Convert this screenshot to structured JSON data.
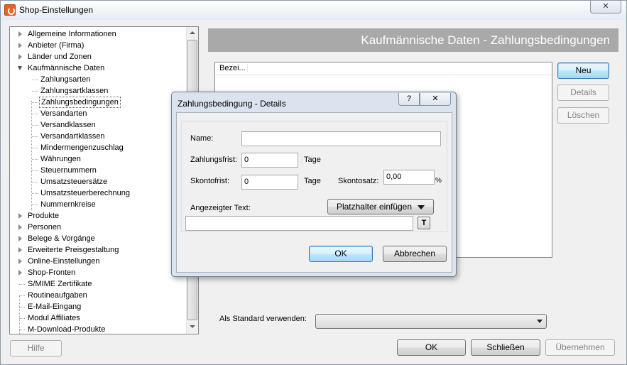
{
  "window": {
    "title": "Shop-Einstellungen",
    "close_glyph": "✕"
  },
  "tree": {
    "items": [
      {
        "label": "Allgemeine Informationen",
        "level": 0,
        "state": "closed"
      },
      {
        "label": "Anbieter (Firma)",
        "level": 0,
        "state": "closed"
      },
      {
        "label": "Länder und Zonen",
        "level": 0,
        "state": "closed"
      },
      {
        "label": "Kaufmännische Daten",
        "level": 0,
        "state": "open"
      },
      {
        "label": "Zahlungsarten",
        "level": 1,
        "state": "leaf"
      },
      {
        "label": "Zahlungsartklassen",
        "level": 1,
        "state": "leaf"
      },
      {
        "label": "Zahlungsbedingungen",
        "level": 1,
        "state": "leaf",
        "selected": true
      },
      {
        "label": "Versandarten",
        "level": 1,
        "state": "leaf"
      },
      {
        "label": "Versandklassen",
        "level": 1,
        "state": "leaf"
      },
      {
        "label": "Versandartklassen",
        "level": 1,
        "state": "leaf"
      },
      {
        "label": "Mindermengenzuschlag",
        "level": 1,
        "state": "leaf"
      },
      {
        "label": "Währungen",
        "level": 1,
        "state": "leaf"
      },
      {
        "label": "Steuernummern",
        "level": 1,
        "state": "leaf"
      },
      {
        "label": "Umsatzsteuersätze",
        "level": 1,
        "state": "leaf"
      },
      {
        "label": "Umsatzsteuerberechnung",
        "level": 1,
        "state": "leaf"
      },
      {
        "label": "Nummernkreise",
        "level": 1,
        "state": "leaf"
      },
      {
        "label": "Produkte",
        "level": 0,
        "state": "closed"
      },
      {
        "label": "Personen",
        "level": 0,
        "state": "closed"
      },
      {
        "label": "Belege & Vorgänge",
        "level": 0,
        "state": "closed"
      },
      {
        "label": "Erweiterte Preisgestaltung",
        "level": 0,
        "state": "closed"
      },
      {
        "label": "Online-Einstellungen",
        "level": 0,
        "state": "closed"
      },
      {
        "label": "Shop-Fronten",
        "level": 0,
        "state": "closed"
      },
      {
        "label": "S/MIME Zertifikate",
        "level": 0,
        "state": "leaf"
      },
      {
        "label": "Routineaufgaben",
        "level": 0,
        "state": "leaf"
      },
      {
        "label": "E-Mail-Eingang",
        "level": 0,
        "state": "leaf"
      },
      {
        "label": "Modul Affiliates",
        "level": 0,
        "state": "leaf"
      },
      {
        "label": "M-Download-Produkte",
        "level": 0,
        "state": "leaf"
      }
    ]
  },
  "main": {
    "header_title": "Kaufmännische Daten - Zahlungsbedingungen",
    "list_column": "Bezei...",
    "buttons": {
      "new": "Neu",
      "details": "Details",
      "delete": "Löschen"
    },
    "standard_label": "Als Standard verwenden:",
    "standard_value": ""
  },
  "footer": {
    "help": "Hilfe",
    "ok": "OK",
    "close": "Schließen",
    "apply": "Übernehmen"
  },
  "dialog": {
    "title": "Zahlungsbedingung - Details",
    "help_glyph": "?",
    "close_glyph": "✕",
    "name_label": "Name:",
    "name_value": "",
    "payment_term_label": "Zahlungsfrist:",
    "payment_term_value": "0",
    "payment_term_unit": "Tage",
    "discount_term_label": "Skontofrist:",
    "discount_term_value": "0",
    "discount_term_unit": "Tage",
    "discount_rate_label": "Skontosatz:",
    "discount_rate_value": "0,00",
    "discount_rate_unit": "%",
    "display_text_label": "Angezeigter Text:",
    "placeholder_button": "Platzhalter einfügen",
    "display_text_value": "",
    "t_button": "T",
    "ok": "OK",
    "cancel": "Abbrechen"
  }
}
